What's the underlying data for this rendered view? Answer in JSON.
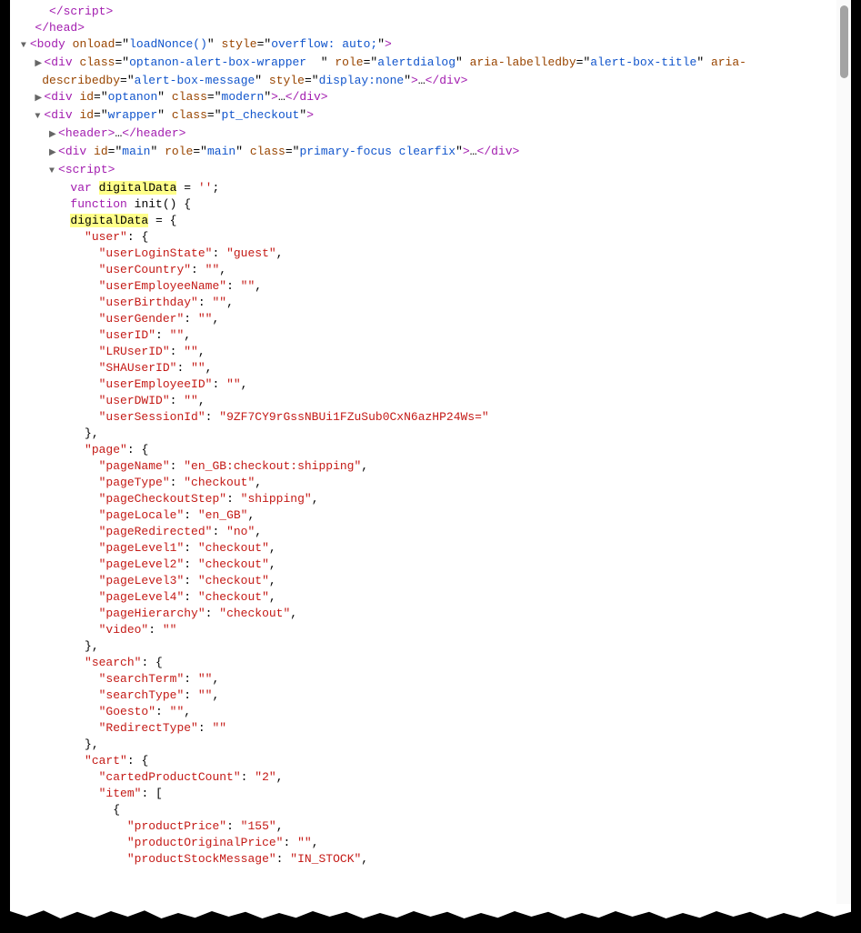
{
  "ind1": "     ",
  "ind2": "   ",
  "ind3": "    ",
  "ind4": "      ",
  "ind5": "        ",
  "ind6": "          ",
  "ind7": "            ",
  "tags": {
    "scriptClose": "</script",
    "headClose": "</head>",
    "body": "body",
    "div": "div",
    "header": "header",
    "script": "script"
  },
  "attrs": {
    "onload": "onload",
    "style": "style",
    "class": "class",
    "role": "role",
    "ariaLabelledby": "aria-labelledby",
    "ariaDescribedby": "aria-describedby",
    "id": "id"
  },
  "vals": {
    "loadNonce": "loadNonce()",
    "overflow": "overflow: auto;",
    "alertWrapper": "optanon-alert-box-wrapper  ",
    "alertdialog": "alertdialog",
    "alertTitle": "alert-box-title",
    "alertMsg": "alert-box-message",
    "displayNone": "display:none",
    "optanon": "optanon",
    "modern": "modern",
    "wrapper": "wrapper",
    "ptCheckout": "pt_checkout",
    "main": "main",
    "primaryFocus": "primary-focus clearfix"
  },
  "js": {
    "var": "var",
    "function": "function",
    "init": "init",
    "digitalData": "digitalData",
    "empty": "''",
    "eq": " = ",
    "openObj": "{",
    "closeObj": "}",
    "openArr": "[",
    "comma": ","
  },
  "user": {
    "key": "\"user\"",
    "userLoginState": "\"userLoginState\"",
    "guest": "\"guest\"",
    "userCountry": "\"userCountry\"",
    "userEmployeeName": "\"userEmployeeName\"",
    "userBirthday": "\"userBirthday\"",
    "userGender": "\"userGender\"",
    "userID": "\"userID\"",
    "LRUserID": "\"LRUserID\"",
    "SHAUserID": "\"SHAUserID\"",
    "userEmployeeID": "\"userEmployeeID\"",
    "userDWID": "\"userDWID\"",
    "userSessionId": "\"userSessionId\"",
    "sessionVal": "\"9ZF7CY9rGssNBUi1FZuSub0CxN6azHP24Ws=\"",
    "emptyStr": "\"\""
  },
  "page": {
    "key": "\"page\"",
    "pageName": "\"pageName\"",
    "pageNameVal": "\"en_GB:checkout:shipping\"",
    "pageType": "\"pageType\"",
    "checkout": "\"checkout\"",
    "pageCheckoutStep": "\"pageCheckoutStep\"",
    "shipping": "\"shipping\"",
    "pageLocale": "\"pageLocale\"",
    "enGB": "\"en_GB\"",
    "pageRedirected": "\"pageRedirected\"",
    "no": "\"no\"",
    "pageLevel1": "\"pageLevel1\"",
    "pageLevel2": "\"pageLevel2\"",
    "pageLevel3": "\"pageLevel3\"",
    "pageLevel4": "\"pageLevel4\"",
    "pageHierarchy": "\"pageHierarchy\"",
    "video": "\"video\""
  },
  "search": {
    "key": "\"search\"",
    "searchTerm": "\"searchTerm\"",
    "searchType": "\"searchType\"",
    "Goesto": "\"Goesto\"",
    "RedirectType": "\"RedirectType\""
  },
  "cart": {
    "key": "\"cart\"",
    "cartedProductCount": "\"cartedProductCount\"",
    "two": "\"2\"",
    "item": "\"item\"",
    "productPrice": "\"productPrice\"",
    "price155": "\"155\"",
    "productOriginalPrice": "\"productOriginalPrice\"",
    "productStockMessage": "\"productStockMessage\"",
    "inStock": "\"IN_STOCK\""
  }
}
